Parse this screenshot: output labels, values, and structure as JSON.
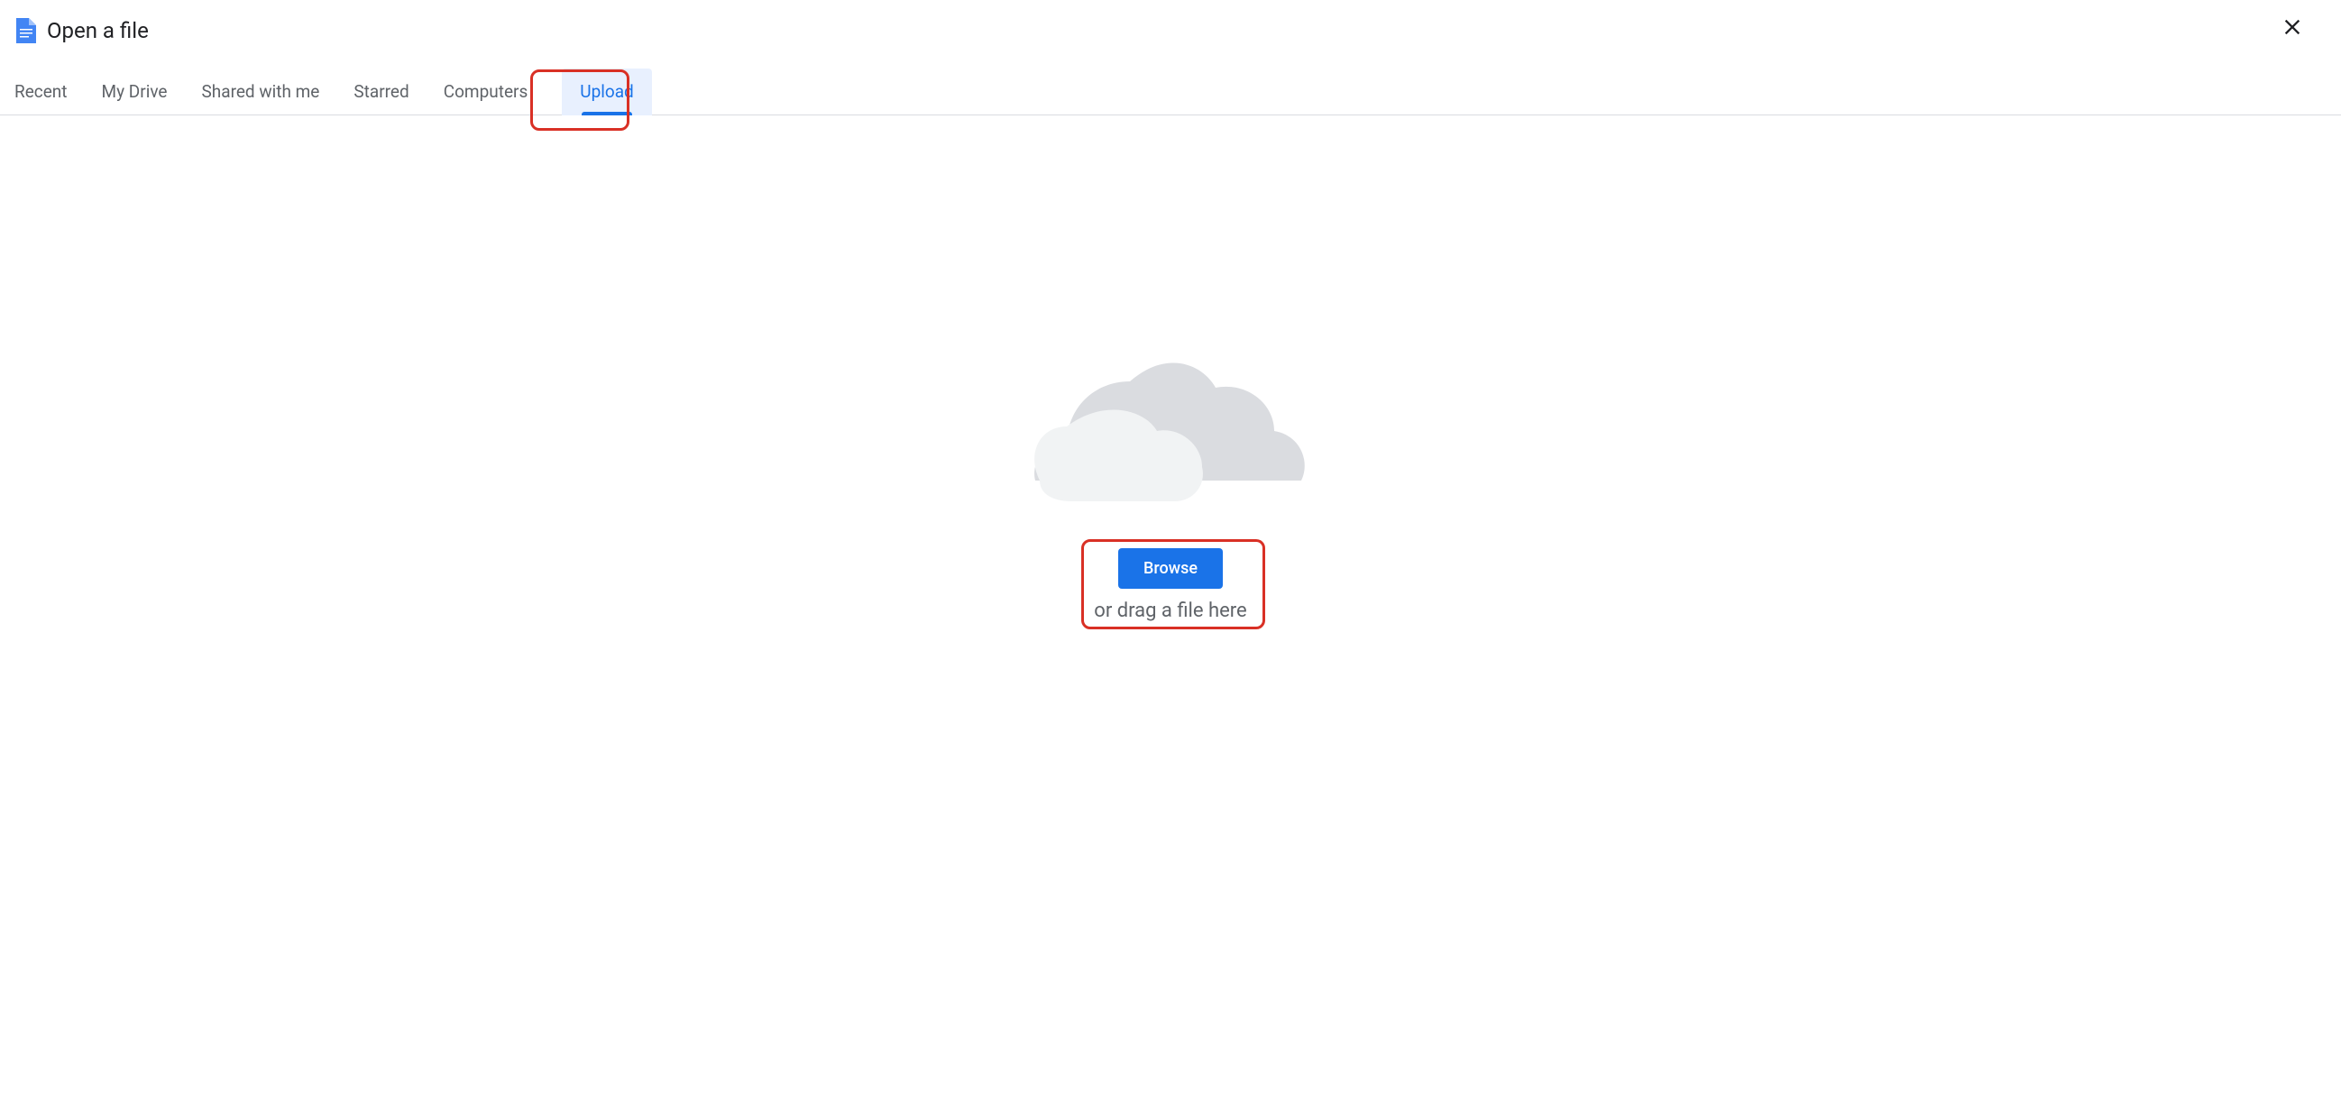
{
  "header": {
    "title": "Open a file"
  },
  "tabs": [
    {
      "label": "Recent",
      "active": false
    },
    {
      "label": "My Drive",
      "active": false
    },
    {
      "label": "Shared with me",
      "active": false
    },
    {
      "label": "Starred",
      "active": false
    },
    {
      "label": "Computers",
      "active": false
    },
    {
      "label": "Upload",
      "active": true
    }
  ],
  "upload": {
    "browse_label": "Browse",
    "drag_text": "or drag a file here"
  }
}
